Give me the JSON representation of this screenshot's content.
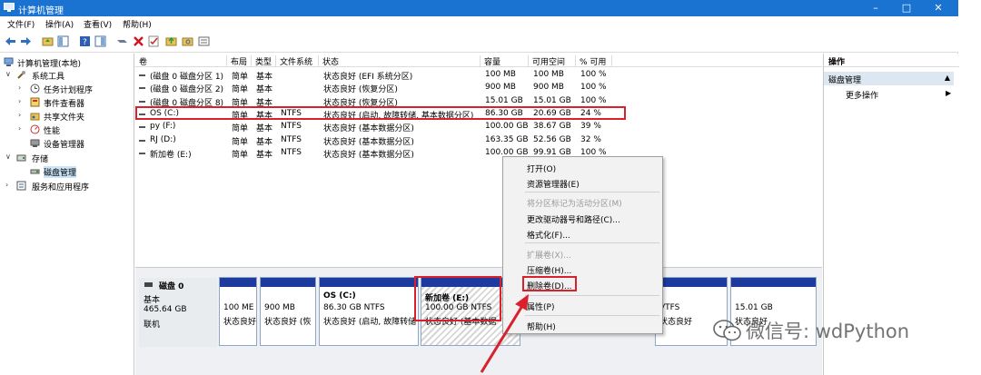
{
  "window": {
    "title": "计算机管理",
    "min": "–",
    "max": "□",
    "close": "✕"
  },
  "menu": [
    "文件(F)",
    "操作(A)",
    "查看(V)",
    "帮助(H)"
  ],
  "tree": {
    "root": "计算机管理(本地)",
    "system_tools": "系统工具",
    "task_scheduler": "任务计划程序",
    "event_viewer": "事件查看器",
    "shared_folders": "共享文件夹",
    "performance": "性能",
    "device_manager": "设备管理器",
    "storage": "存储",
    "disk_management": "磁盘管理",
    "services_apps": "服务和应用程序"
  },
  "columns": [
    "卷",
    "布局",
    "类型",
    "文件系统",
    "状态",
    "容量",
    "可用空间",
    "% 可用"
  ],
  "volumes": [
    {
      "name": "(磁盘 0 磁盘分区 1)",
      "layout": "简单",
      "type": "基本",
      "fs": "",
      "status": "状态良好 (EFI 系统分区)",
      "capacity": "100 MB",
      "free": "100 MB",
      "pct": "100 %"
    },
    {
      "name": "(磁盘 0 磁盘分区 2)",
      "layout": "简单",
      "type": "基本",
      "fs": "",
      "status": "状态良好 (恢复分区)",
      "capacity": "900 MB",
      "free": "900 MB",
      "pct": "100 %"
    },
    {
      "name": "(磁盘 0 磁盘分区 8)",
      "layout": "简单",
      "type": "基本",
      "fs": "",
      "status": "状态良好 (恢复分区)",
      "capacity": "15.01 GB",
      "free": "15.01 GB",
      "pct": "100 %"
    },
    {
      "name": "OS (C:)",
      "layout": "简单",
      "type": "基本",
      "fs": "NTFS",
      "status": "状态良好 (启动, 故障转储, 基本数据分区)",
      "capacity": "86.30 GB",
      "free": "20.69 GB",
      "pct": "24 %"
    },
    {
      "name": "py (F:)",
      "layout": "简单",
      "type": "基本",
      "fs": "NTFS",
      "status": "状态良好 (基本数据分区)",
      "capacity": "100.00 GB",
      "free": "38.67 GB",
      "pct": "39 %"
    },
    {
      "name": "RJ (D:)",
      "layout": "简单",
      "type": "基本",
      "fs": "NTFS",
      "status": "状态良好 (基本数据分区)",
      "capacity": "163.35 GB",
      "free": "52.56 GB",
      "pct": "32 %"
    },
    {
      "name": "新加卷 (E:)",
      "layout": "简单",
      "type": "基本",
      "fs": "NTFS",
      "status": "状态良好 (基本数据分区)",
      "capacity": "100.00 GB",
      "free": "99.91 GB",
      "pct": "100 %"
    }
  ],
  "disk": {
    "name": "磁盘 0",
    "kind": "基本",
    "size": "465.64 GB",
    "state": "联机"
  },
  "partitions": [
    {
      "l1": "",
      "l2": "100 ME",
      "l3": "状态良好"
    },
    {
      "l1": "",
      "l2": "900 MB",
      "l3": "状态良好 (恢"
    },
    {
      "l1": "OS  (C:)",
      "l2": "86.30 GB NTFS",
      "l3": "状态良好 (启动, 故障转储"
    },
    {
      "l1": "新加卷  (E:)",
      "l2": "100.00 GB NTFS",
      "l3": "状态良好 (基本数据"
    },
    {
      "l1": "",
      "l2": "VTFS",
      "l3": "状态良好"
    },
    {
      "l1": "",
      "l2": "15.01 GB",
      "l3": "状态良好"
    }
  ],
  "context_menu": [
    {
      "label": "打开(O)",
      "enabled": true
    },
    {
      "label": "资源管理器(E)",
      "enabled": true
    },
    {
      "label": "将分区标记为活动分区(M)",
      "enabled": false
    },
    {
      "label": "更改驱动器号和路径(C)...",
      "enabled": true
    },
    {
      "label": "格式化(F)...",
      "enabled": true
    },
    {
      "label": "扩展卷(X)...",
      "enabled": false
    },
    {
      "label": "压缩卷(H)...",
      "enabled": true
    },
    {
      "label": "删除卷(D)...",
      "enabled": true
    },
    {
      "label": "属性(P)",
      "enabled": true
    },
    {
      "label": "帮助(H)",
      "enabled": true
    }
  ],
  "actions": {
    "header": "操作",
    "section": "磁盘管理",
    "more": "更多操作"
  },
  "watermark": "微信号: wdPython",
  "colors": {
    "titlebar": "#1a73d0",
    "highlight": "#d9202c",
    "partition_bar": "#1d3a9e"
  }
}
